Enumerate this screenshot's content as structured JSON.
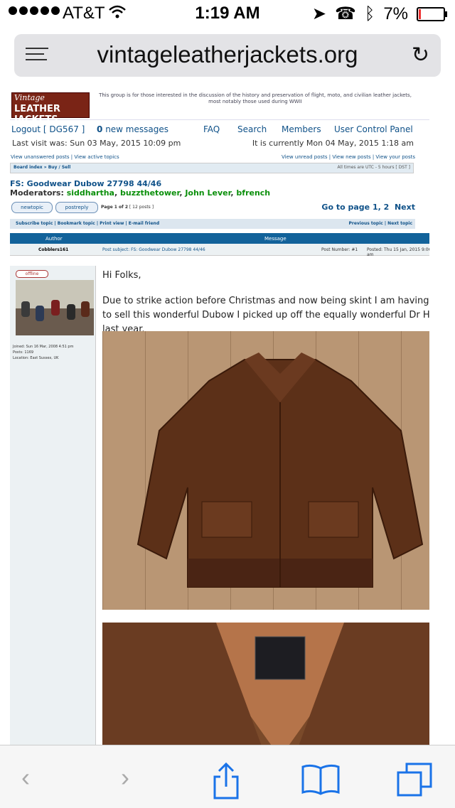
{
  "statusbar": {
    "carrier": "AT&T",
    "time": "1:19 AM",
    "battery": "7%"
  },
  "browser": {
    "url": "vintageleatherjackets.org"
  },
  "site": {
    "logo_line1": "Vintage",
    "logo_line2": "LEATHER JACKETS",
    "description": "This group is for those interested in the discussion of the history and preservation of flight, moto, and civilian leather jackets, most notably those used during WWII"
  },
  "nav": {
    "logout": "Logout [ DG567 ]",
    "messages_count": "0",
    "messages_label": "new messages",
    "faq": "FAQ",
    "search": "Search",
    "members": "Members",
    "ucp": "User Control Panel"
  },
  "visit": {
    "last": "Last visit was: Sun 03 May, 2015 10:09 pm",
    "current": "It is currently Mon 04 May, 2015 1:18 am"
  },
  "quicklinks": {
    "left": "View unanswered posts | View active topics",
    "right": "View unread posts | View new posts | View your posts"
  },
  "breadcrumb": {
    "path": "Board index » Buy / Sell",
    "tz": "All times are UTC - 5 hours [ DST ]"
  },
  "topic": {
    "title": "FS: Goodwear Dubow 27798 44/46",
    "moderators_label": "Moderators:",
    "moderators": [
      "siddhartha",
      "buzzthetower",
      "John Lever",
      "bfrench"
    ],
    "newtopic": "newtopic",
    "postreply": "postreply",
    "page_of": "Page 1 of 2",
    "posts_count": "[ 12 posts ]",
    "goto_label": "Go to page",
    "page1": "1",
    "page2": "2",
    "next": "Next",
    "tools": "Subscribe topic | Bookmark topic | Print view | E-mail friend",
    "prevnext": "Previous topic | Next topic"
  },
  "table": {
    "author": "Author",
    "message": "Message"
  },
  "post": {
    "author": "Cobblers161",
    "subject": "Post subject: FS: Goodwear Dubow 27798 44/46",
    "number": "Post Number: #1",
    "posted": "Posted: Thu 15 Jan, 2015 9:06 am",
    "status": "offline",
    "joined": "Joined: Sun 16 Mar, 2008 4:51 pm",
    "posts": "Posts: 1169",
    "location": "Location: East Sussex, UK",
    "greeting": "Hi Folks,",
    "body": "Due to strike action before Christmas and now being skint I am having to sell this wonderful Dubow I picked up off the equally wonderful Dr H last year."
  }
}
